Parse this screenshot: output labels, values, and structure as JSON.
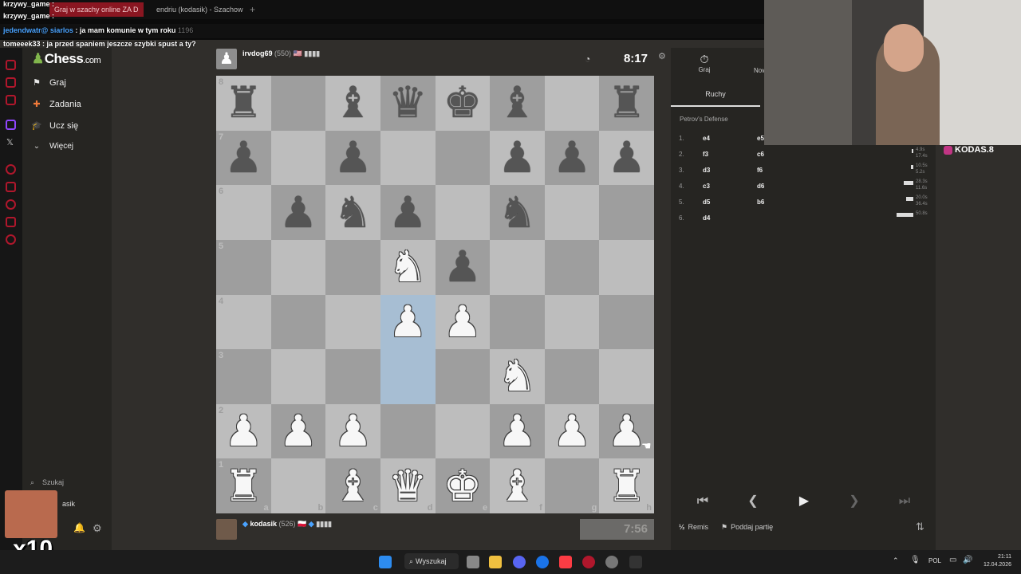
{
  "browser": {
    "tabs": [
      {
        "label": "Graj w szachy online ZA D"
      },
      {
        "label": "endriu (kodasik) - Szachow"
      }
    ],
    "new_tab": "+"
  },
  "chat": [
    {
      "user": "krzywy_game :",
      "text": ""
    },
    {
      "user": "krzywy_game :",
      "text": ""
    },
    {
      "user": "jedendwatr@",
      "user2": "siarlos",
      "text": ": ja mam komunie w tym roku",
      "count": "1196"
    },
    {
      "user": "tomeeek33 :",
      "text": "ja przed spaniem jeszcze szybki spust a ty?"
    }
  ],
  "sidebar": {
    "logo": "Chess",
    "logo_suffix": ".com",
    "items": [
      {
        "label": "Graj",
        "icon": "play-icon"
      },
      {
        "label": "Zadania",
        "icon": "puzzle-icon"
      },
      {
        "label": "Ucz się",
        "icon": "learn-icon"
      },
      {
        "label": "Więcej",
        "icon": "chevron-down-icon"
      }
    ],
    "search_label": "Szukaj",
    "user_label": "asik"
  },
  "top_player": {
    "name": "irvdog69",
    "rating": "(550)",
    "flag": "🇺🇸",
    "clock": "8:17"
  },
  "bottom_player": {
    "name": "kodasik",
    "rating": "(526)",
    "flag": "🇵🇱",
    "clock": "7:56"
  },
  "board": {
    "ranks": [
      "8",
      "7",
      "6",
      "5",
      "4",
      "3",
      "2",
      "1"
    ],
    "files": [
      "a",
      "b",
      "c",
      "d",
      "e",
      "f",
      "g",
      "h"
    ],
    "rows": [
      [
        "bR",
        "",
        "bB",
        "bQ",
        "bK",
        "bB",
        "",
        "bR"
      ],
      [
        "bP",
        "",
        "bP",
        "",
        "",
        "bP",
        "bP",
        "bP"
      ],
      [
        "",
        "bP",
        "bN",
        "bP",
        "",
        "bN",
        "",
        ""
      ],
      [
        "",
        "",
        "",
        "wN",
        "bP",
        "",
        "",
        ""
      ],
      [
        "",
        "",
        "",
        "wP",
        "wP",
        "",
        "",
        ""
      ],
      [
        "",
        "",
        "",
        "",
        "",
        "wN",
        "",
        ""
      ],
      [
        "wP",
        "wP",
        "wP",
        "",
        "",
        "wP",
        "wP",
        "wP"
      ],
      [
        "wR",
        "",
        "wB",
        "wQ",
        "wK",
        "wB",
        "",
        "wR"
      ]
    ],
    "highlight": [
      "d4",
      "d3"
    ]
  },
  "right_panel": {
    "tabs": [
      {
        "label": "Graj",
        "icon": "stopwatch-icon"
      },
      {
        "label": "Now"
      }
    ],
    "moves_tab": "Ruchy",
    "opening": "Petrov's Defense",
    "moves": [
      {
        "num": "1.",
        "white": "e4",
        "black": "e5"
      },
      {
        "num": "2.",
        "white": "f3",
        "black": "c6"
      },
      {
        "num": "3.",
        "white": "d3",
        "black": "f6"
      },
      {
        "num": "4.",
        "white": "c3",
        "black": "d6"
      },
      {
        "num": "5.",
        "white": "d5",
        "black": "b6"
      },
      {
        "num": "6.",
        "white": "d4",
        "black": ""
      }
    ],
    "times": [
      {
        "top": "4.9s",
        "bottom": "17.4s",
        "frac": 0.05
      },
      {
        "top": "10.5s",
        "bottom": "5.2s",
        "frac": 0.1
      },
      {
        "top": "28.3s",
        "bottom": "11.6s",
        "frac": 0.4
      },
      {
        "top": "20.0s",
        "bottom": "36.4s",
        "frac": 0.3
      },
      {
        "top": "50.8s",
        "bottom": "",
        "frac": 0.7
      }
    ],
    "draw_label": "Remis",
    "resign_label": "Poddaj partię"
  },
  "overlay": {
    "instagram": "KODAS.8",
    "multiplier": "x10"
  },
  "taskbar": {
    "search": "Wyszukaj",
    "lang": "POL",
    "time": "21:11",
    "date": "12.04.2026"
  }
}
